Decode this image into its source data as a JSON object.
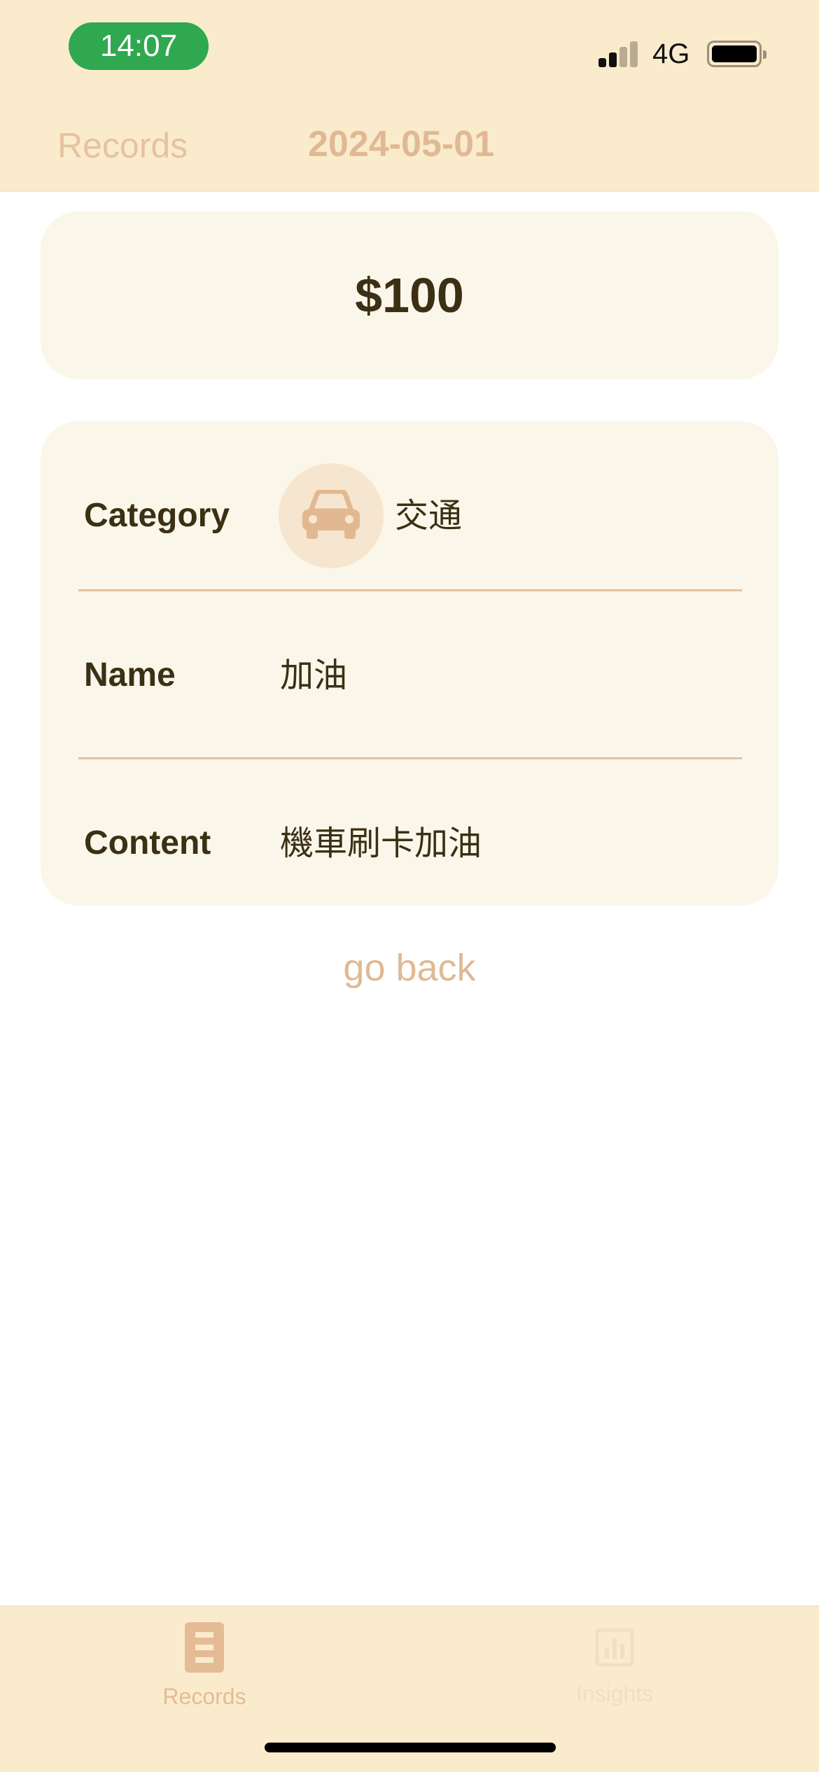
{
  "status_bar": {
    "time": "14:07",
    "network": "4G",
    "time_pill_color": "#2fa84f"
  },
  "nav": {
    "back_label": "Records",
    "title": "2024-05-01"
  },
  "expense": {
    "amount": "$100",
    "category_label": "Category",
    "category_value": "交通",
    "category_icon": "car-icon",
    "name_label": "Name",
    "name_value": "加油",
    "content_label": "Content",
    "content_value": "機車刷卡加油"
  },
  "go_back_label": "go back",
  "tab_bar": {
    "records": {
      "label": "Records",
      "icon": "records-icon",
      "active": true
    },
    "insights": {
      "label": "Insights",
      "icon": "insights-icon",
      "active": false
    }
  },
  "colors": {
    "header_bg": "#faebcc",
    "card_bg": "#fbf6ea",
    "accent": "#e0b994",
    "text_dark": "#3b3014"
  }
}
